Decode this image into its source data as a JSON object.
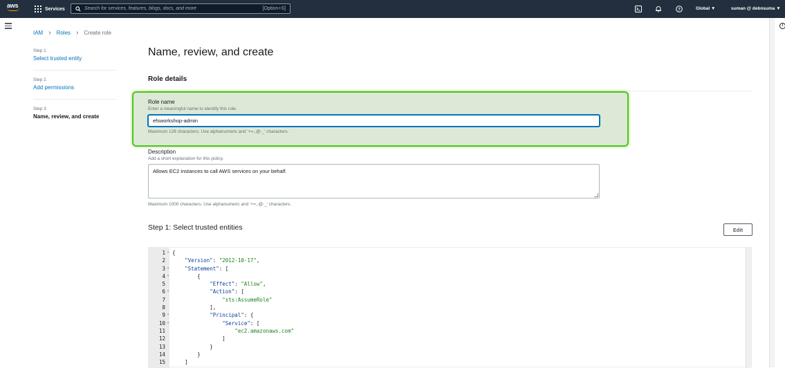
{
  "topbar": {
    "logo_text": "aws",
    "services_label": "Services",
    "search_placeholder": "Search for services, features, blogs, docs, and more",
    "search_shortcut": "[Option+S]",
    "region_label": "Global",
    "account_label": "suman @ debnsuma"
  },
  "breadcrumb": {
    "items": [
      "IAM",
      "Roles"
    ],
    "current": "Create role"
  },
  "steps": [
    {
      "num": "Step 1",
      "label": "Select trusted entity"
    },
    {
      "num": "Step 2",
      "label": "Add permissions"
    },
    {
      "num": "Step 3",
      "label": "Name, review, and create"
    }
  ],
  "page": {
    "title": "Name, review, and create",
    "section_title": "Role details"
  },
  "role_name": {
    "label": "Role name",
    "hint": "Enter a meaningful name to identify this role.",
    "value": "efsworkshop-admin",
    "constraint": "Maximum 128 characters. Use alphanumeric and '+=,.@-_' characters."
  },
  "description": {
    "label": "Description",
    "hint": "Add a short explanation for this policy.",
    "value": "Allows EC2 instances to call AWS services on your behalf.",
    "constraint": "Maximum 1000 characters. Use alphanumeric and '+=,.@-_' characters."
  },
  "trusted_entities": {
    "heading": "Step 1: Select trusted entities",
    "edit_label": "Edit"
  },
  "code_lines": [
    {
      "n": "1",
      "fold": "▾",
      "indent": "",
      "parts": [
        [
          "p",
          "{"
        ]
      ]
    },
    {
      "n": "2",
      "fold": "",
      "indent": "    ",
      "parts": [
        [
          "k",
          "\"Version\""
        ],
        [
          "p",
          ": "
        ],
        [
          "s",
          "\"2012-10-17\""
        ],
        [
          "p",
          ","
        ]
      ]
    },
    {
      "n": "3",
      "fold": "▾",
      "indent": "    ",
      "parts": [
        [
          "k",
          "\"Statement\""
        ],
        [
          "p",
          ": ["
        ]
      ]
    },
    {
      "n": "4",
      "fold": "▾",
      "indent": "        ",
      "parts": [
        [
          "p",
          "{"
        ]
      ]
    },
    {
      "n": "5",
      "fold": "",
      "indent": "            ",
      "parts": [
        [
          "k",
          "\"Effect\""
        ],
        [
          "p",
          ": "
        ],
        [
          "s",
          "\"Allow\""
        ],
        [
          "p",
          ","
        ]
      ]
    },
    {
      "n": "6",
      "fold": "▾",
      "indent": "            ",
      "parts": [
        [
          "k",
          "\"Action\""
        ],
        [
          "p",
          ": ["
        ]
      ]
    },
    {
      "n": "7",
      "fold": "",
      "indent": "                ",
      "parts": [
        [
          "s",
          "\"sts:AssumeRole\""
        ]
      ]
    },
    {
      "n": "8",
      "fold": "",
      "indent": "            ",
      "parts": [
        [
          "p",
          "],"
        ]
      ]
    },
    {
      "n": "9",
      "fold": "▾",
      "indent": "            ",
      "parts": [
        [
          "k",
          "\"Principal\""
        ],
        [
          "p",
          ": {"
        ]
      ]
    },
    {
      "n": "10",
      "fold": "▾",
      "indent": "                ",
      "parts": [
        [
          "k",
          "\"Service\""
        ],
        [
          "p",
          ": ["
        ]
      ]
    },
    {
      "n": "11",
      "fold": "",
      "indent": "                    ",
      "parts": [
        [
          "s",
          "\"ec2.amazonaws.com\""
        ]
      ]
    },
    {
      "n": "12",
      "fold": "",
      "indent": "                ",
      "parts": [
        [
          "p",
          "]"
        ]
      ]
    },
    {
      "n": "13",
      "fold": "",
      "indent": "            ",
      "parts": [
        [
          "p",
          "}"
        ]
      ]
    },
    {
      "n": "14",
      "fold": "",
      "indent": "        ",
      "parts": [
        [
          "p",
          "}"
        ]
      ]
    },
    {
      "n": "15",
      "fold": "",
      "indent": "    ",
      "parts": [
        [
          "p",
          "]"
        ]
      ]
    }
  ],
  "colors": {
    "topbar": "#232f3e",
    "link": "#0073bb",
    "highlight_border": "#52c41a",
    "highlight_fill": "#dce9d6"
  }
}
